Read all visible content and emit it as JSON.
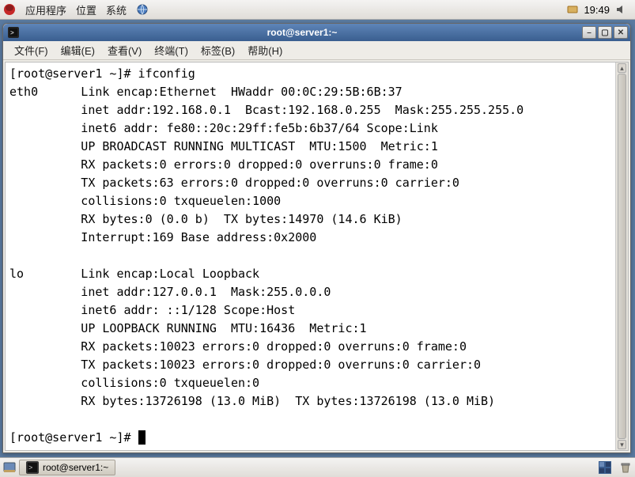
{
  "top_panel": {
    "menu1": "应用程序",
    "menu2": "位置",
    "menu3": "系统",
    "clock": "19:49"
  },
  "window": {
    "title": "root@server1:~",
    "menus": {
      "file": "文件(F)",
      "edit": "编辑(E)",
      "view": "查看(V)",
      "terminal": "终端(T)",
      "tabs": "标签(B)",
      "help": "帮助(H)"
    }
  },
  "terminal": {
    "prompt1": "[root@server1 ~]# ",
    "cmd": "ifconfig",
    "eth0_lines": [
      "eth0      Link encap:Ethernet  HWaddr 00:0C:29:5B:6B:37",
      "          inet addr:192.168.0.1  Bcast:192.168.0.255  Mask:255.255.255.0",
      "          inet6 addr: fe80::20c:29ff:fe5b:6b37/64 Scope:Link",
      "          UP BROADCAST RUNNING MULTICAST  MTU:1500  Metric:1",
      "          RX packets:0 errors:0 dropped:0 overruns:0 frame:0",
      "          TX packets:63 errors:0 dropped:0 overruns:0 carrier:0",
      "          collisions:0 txqueuelen:1000",
      "          RX bytes:0 (0.0 b)  TX bytes:14970 (14.6 KiB)",
      "          Interrupt:169 Base address:0x2000"
    ],
    "lo_lines": [
      "lo        Link encap:Local Loopback",
      "          inet addr:127.0.0.1  Mask:255.0.0.0",
      "          inet6 addr: ::1/128 Scope:Host",
      "          UP LOOPBACK RUNNING  MTU:16436  Metric:1",
      "          RX packets:10023 errors:0 dropped:0 overruns:0 frame:0",
      "          TX packets:10023 errors:0 dropped:0 overruns:0 carrier:0",
      "          collisions:0 txqueuelen:0",
      "          RX bytes:13726198 (13.0 MiB)  TX bytes:13726198 (13.0 MiB)"
    ],
    "prompt2": "[root@server1 ~]# "
  },
  "taskbar": {
    "task1": "root@server1:~"
  }
}
